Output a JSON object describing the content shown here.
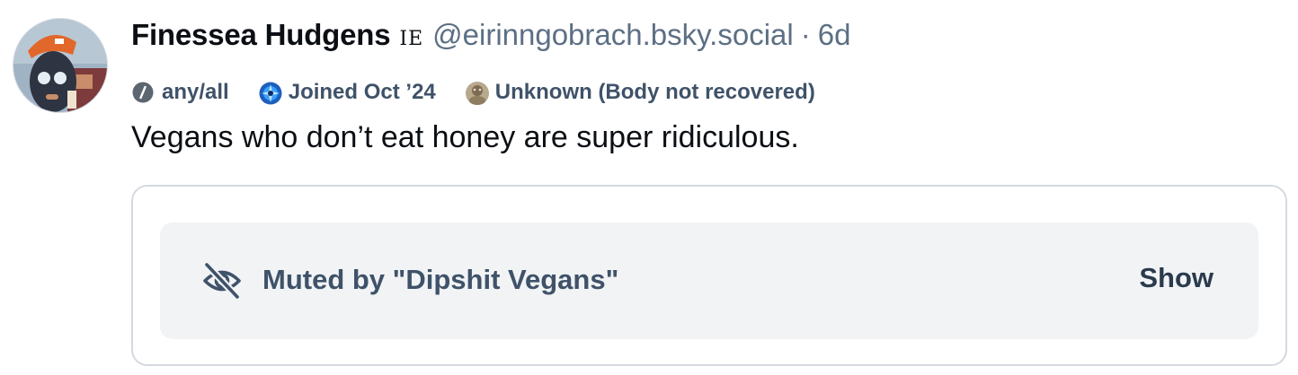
{
  "post": {
    "author": {
      "display_name": "Finessea Hudgens",
      "flag": "IE",
      "handle": "@eirinngobrach.bsky.social",
      "separator": "·",
      "time": "6d"
    },
    "badges": [
      {
        "icon": "pronouns-icon",
        "label": "any/all"
      },
      {
        "icon": "joined-globe-icon",
        "label": "Joined Oct ’24"
      },
      {
        "icon": "status-avatar-icon",
        "label": "Unknown (Body not recovered)"
      }
    ],
    "text": "Vegans who don’t eat honey are super ridiculous.",
    "muted_embed": {
      "icon": "eye-slash-icon",
      "label": "Muted by \"Dipshit Vegans\"",
      "action_label": "Show"
    }
  },
  "colors": {
    "primary_text": "#0b0f14",
    "secondary_text": "#5c6f84",
    "badge_text": "#3f5269",
    "embed_border": "#d4d9e1",
    "mute_background": "#f1f3f5"
  }
}
